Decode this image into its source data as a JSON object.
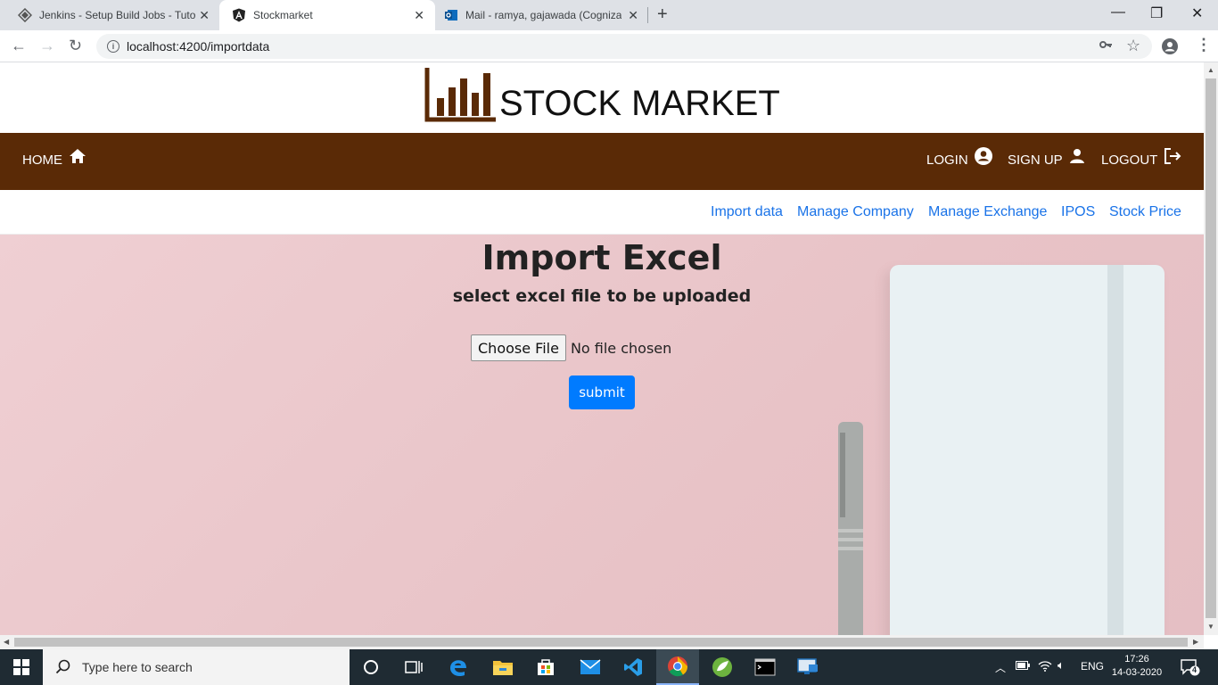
{
  "browser": {
    "tabs": [
      {
        "title": "Jenkins - Setup Build Jobs - Tutor",
        "active": false,
        "icon": "jenkins-icon"
      },
      {
        "title": "Stockmarket",
        "active": true,
        "icon": "angular-icon"
      },
      {
        "title": "Mail - ramya, gajawada (Cognizant",
        "active": false,
        "icon": "outlook-icon"
      }
    ],
    "url": "localhost:4200/importdata"
  },
  "site": {
    "logo_text": "STOCK MARKET",
    "nav": {
      "home": "HOME",
      "login": "LOGIN",
      "signup": "SIGN UP",
      "logout": "LOGOUT"
    },
    "subnav": [
      "Import data",
      "Manage Company",
      "Manage Exchange",
      "IPOS",
      "Stock Price"
    ],
    "colors": {
      "navbar": "#5a2a06",
      "link": "#1a73e8",
      "primary_button": "#007bff"
    }
  },
  "main": {
    "title": "Import Excel",
    "subtitle": "select excel file to be uploaded",
    "file_button": "Choose File",
    "file_status": "No file chosen",
    "submit_label": "submit"
  },
  "taskbar": {
    "search_placeholder": "Type here to search",
    "language": "ENG",
    "time": "17:26",
    "date": "14-03-2020",
    "notifications": "4"
  }
}
